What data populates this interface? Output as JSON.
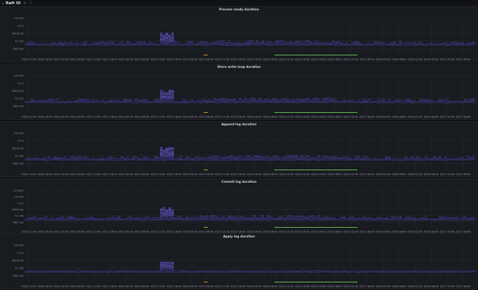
{
  "row": {
    "title": "Raft IO",
    "collapse_icon": "chevron-down-icon",
    "icons": [
      "gear-icon",
      "drag-handle-icon"
    ]
  },
  "colors": {
    "heat": "#3a3376",
    "heat_bright": "#5a4fb3",
    "green": "#6ccf5a",
    "orange": "#e0a33a",
    "grid": "#2a2d33",
    "text": "#9fa1ab"
  },
  "x_ticks": [
    "03/10 12:00",
    "03/10 18:00",
    "03/11 00:00",
    "03/11 06:00",
    "03/11 12:00",
    "03/11 18:00",
    "03/12 00:00",
    "03/12 06:00",
    "03/12 12:00",
    "03/12 18:00",
    "03/13 00:00",
    "03/13 06:00",
    "03/13 12:00",
    "03/13 18:00",
    "03/14 00:00",
    "03/14 06:00",
    "03/14 12:00",
    "03/14 18:00",
    "03/15 00:00",
    "03/15 06:00",
    "03/15 12:00",
    "03/15 18:00",
    "03/16 00:00",
    "03/16 06:00",
    "03/16 12:00",
    "03/16 18:00",
    "03/17 00:00",
    "03/17 06:00"
  ],
  "chart_data": [
    {
      "type": "heatmap",
      "title": "Process ready duration",
      "y_ticks": [
        "2.8 min",
        "5.2 s",
        "163.8 ms",
        "5.1 ms",
        "160.0 µs"
      ]
    },
    {
      "type": "heatmap",
      "title": "Store write loop duration",
      "y_ticks": [
        "2.8 min",
        "5.2 s",
        "163.8 ms",
        "5.1 ms",
        "160.0 µs"
      ]
    },
    {
      "type": "heatmap",
      "title": "Append log duration",
      "y_ticks": [
        "2.8 min",
        "5.2 s",
        "163.8 ms",
        "5.1 ms",
        "160.0 µs"
      ]
    },
    {
      "type": "heatmap",
      "title": "Commit log duration",
      "y_ticks": [
        "1.5 hour",
        "2.8 min",
        "5.2 s",
        "163.8 ms",
        "5.1 ms",
        "160.0 µs"
      ]
    },
    {
      "type": "heatmap",
      "title": "Apply log duration",
      "y_ticks": [
        "2.8 min",
        "5.2 s",
        "163.8 ms",
        "5.1 ms",
        "160.0 µs"
      ]
    }
  ]
}
